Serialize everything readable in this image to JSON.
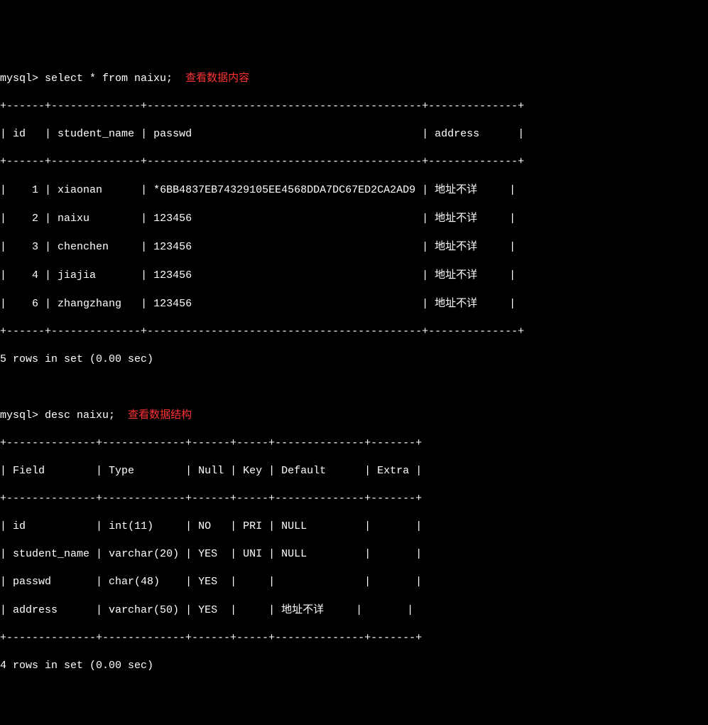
{
  "prompt": "mysql>",
  "query1": {
    "command": "select * from naixu;",
    "annotation": "查看数据内容",
    "headers": {
      "id": "id",
      "student_name": "student_name",
      "passwd": "passwd",
      "address": "address"
    },
    "rows": [
      {
        "id": "1",
        "student_name": "xiaonan",
        "passwd": "*6BB4837EB74329105EE4568DDA7DC67ED2CA2AD9",
        "address": "地址不详"
      },
      {
        "id": "2",
        "student_name": "naixu",
        "passwd": "123456",
        "address": "地址不详"
      },
      {
        "id": "3",
        "student_name": "chenchen",
        "passwd": "123456",
        "address": "地址不详"
      },
      {
        "id": "4",
        "student_name": "jiajia",
        "passwd": "123456",
        "address": "地址不详"
      },
      {
        "id": "6",
        "student_name": "zhangzhang",
        "passwd": "123456",
        "address": "地址不详"
      }
    ],
    "footer": "5 rows in set (0.00 sec)"
  },
  "query2": {
    "command": "desc naixu;",
    "annotation": "查看数据结构",
    "headers": {
      "field": "Field",
      "type": "Type",
      "null": "Null",
      "key": "Key",
      "default": "Default",
      "extra": "Extra"
    },
    "rows": [
      {
        "field": "id",
        "type": "int(11)",
        "null": "NO",
        "key": "PRI",
        "default": "NULL",
        "extra": ""
      },
      {
        "field": "student_name",
        "type": "varchar(20)",
        "null": "YES",
        "key": "UNI",
        "default": "NULL",
        "extra": ""
      },
      {
        "field": "passwd",
        "type": "char(48)",
        "null": "YES",
        "key": "",
        "default": "",
        "extra": ""
      },
      {
        "field": "address",
        "type": "varchar(50)",
        "null": "YES",
        "key": "",
        "default": "地址不详",
        "extra": ""
      }
    ],
    "footer": "4 rows in set (0.00 sec)"
  },
  "borders": {
    "t1": "+------+--------------+-------------------------------------------+--------------+",
    "t2": "+--------------+-------------+------+-----+--------------+-------+"
  }
}
